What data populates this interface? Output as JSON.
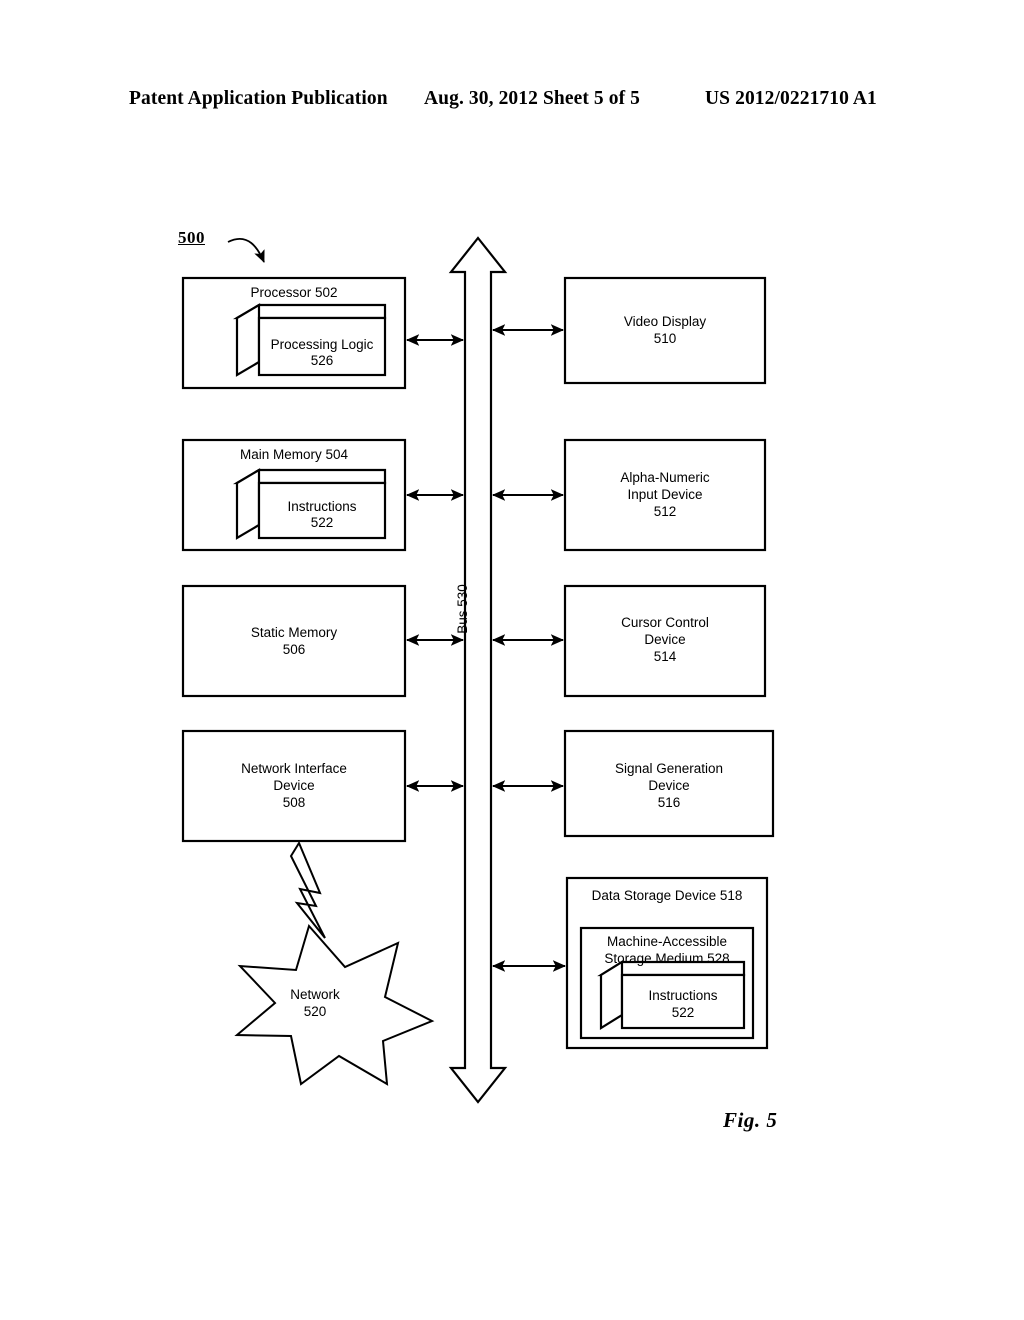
{
  "header": {
    "left": "Patent Application Publication",
    "middle": "Aug. 30, 2012  Sheet 5 of 5",
    "right": "US 2012/0221710 A1"
  },
  "figure": {
    "system_reference": "500",
    "caption": "Fig. 5",
    "bus_label": "Bus 530",
    "colors": {
      "stroke": "#000000",
      "fill": "#ffffff",
      "background": "#ffffff"
    }
  },
  "blocks": {
    "processor": {
      "title": "Processor 502",
      "inner_line1": "Processing Logic",
      "inner_line2": "526"
    },
    "main_memory": {
      "title": "Main Memory 504",
      "inner_line1": "Instructions",
      "inner_line2": "522"
    },
    "static_memory": {
      "line1": "Static Memory",
      "line2": "506"
    },
    "network_interface": {
      "line1": "Network Interface",
      "line2": "Device",
      "line3": "508"
    },
    "network": {
      "line1": "Network",
      "line2": "520"
    },
    "video_display": {
      "line1": "Video Display",
      "line2": "510"
    },
    "alpha_numeric_input": {
      "line1": "Alpha-Numeric",
      "line2": "Input Device",
      "line3": "512"
    },
    "cursor_control": {
      "line1": "Cursor Control",
      "line2": "Device",
      "line3": "514"
    },
    "signal_generation": {
      "line1": "Signal Generation",
      "line2": "Device",
      "line3": "516"
    },
    "data_storage": {
      "title": "Data Storage Device 518",
      "medium_line1": "Machine-Accessible",
      "medium_line2": "Storage Medium 528",
      "inner_line1": "Instructions",
      "inner_line2": "522"
    }
  }
}
